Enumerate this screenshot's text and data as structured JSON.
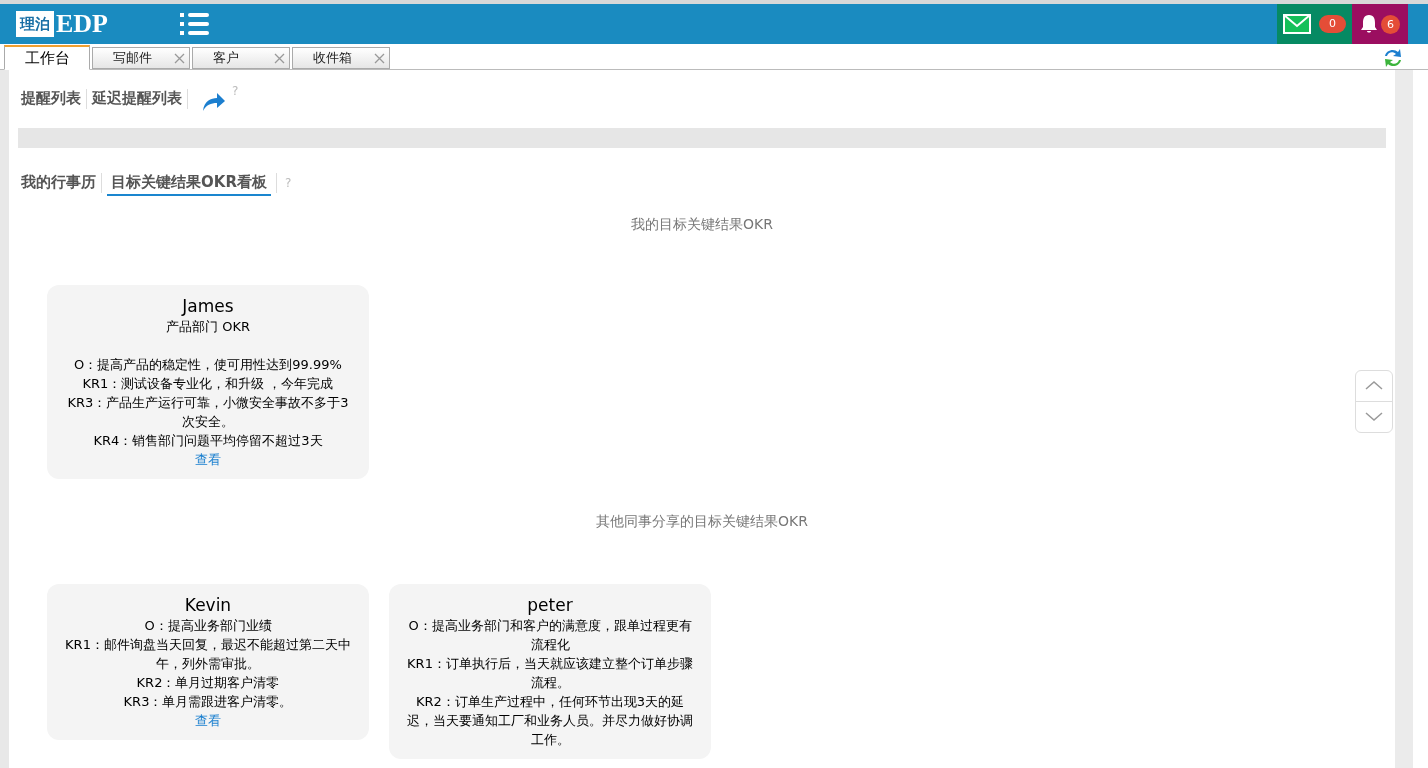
{
  "header": {
    "logo_box": "理泊",
    "logo_text": "EDP",
    "mail_count": "0",
    "alert_count": "6"
  },
  "tabs": [
    {
      "label": "工作台",
      "selected": true,
      "closable": false
    },
    {
      "label": "写邮件",
      "selected": false,
      "closable": true
    },
    {
      "label": "客户",
      "selected": false,
      "closable": true
    },
    {
      "label": "收件箱",
      "selected": false,
      "closable": true
    }
  ],
  "reminder_nav": [
    {
      "label": "提醒列表",
      "selected": false
    },
    {
      "label": "延迟提醒列表",
      "selected": false
    }
  ],
  "help_mark": "?",
  "board_nav": [
    {
      "label": "我的行事历",
      "selected": false
    },
    {
      "label": "目标关键结果OKR看板",
      "selected": true
    }
  ],
  "board_help_mark": "?",
  "my_section": {
    "title": "我的目标关键结果OKR",
    "cards": [
      {
        "name": "James",
        "subtitle": "产品部门 OKR",
        "lines": [
          "O：提高产品的稳定性，使可用性达到99.99%",
          "KR1：测试设备专业化，和升级 ，今年完成",
          "KR3：产品生产运行可靠，小微安全事故不多于3次安全。",
          "KR4：销售部门问题平均停留不超过3天"
        ],
        "link": "查看"
      }
    ]
  },
  "shared_section": {
    "title": "其他同事分享的目标关键结果OKR",
    "cards": [
      {
        "name": "Kevin",
        "lines": [
          "O：提高业务部门业绩",
          "KR1：邮件询盘当天回复，最迟不能超过第二天中午，列外需审批。",
          "KR2：单月过期客户清零",
          "KR3：单月需跟进客户清零。"
        ],
        "link": "查看"
      },
      {
        "name": "peter",
        "lines": [
          "O：提高业务部门和客户的满意度，跟单过程更有流程化",
          "KR1：订单执行后，当天就应该建立整个订单步骤流程。",
          "KR2：订单生产过程中，任何环节出现3天的延迟，当天要通知工厂和业务人员。并尽力做好协调工作。"
        ]
      }
    ]
  }
}
